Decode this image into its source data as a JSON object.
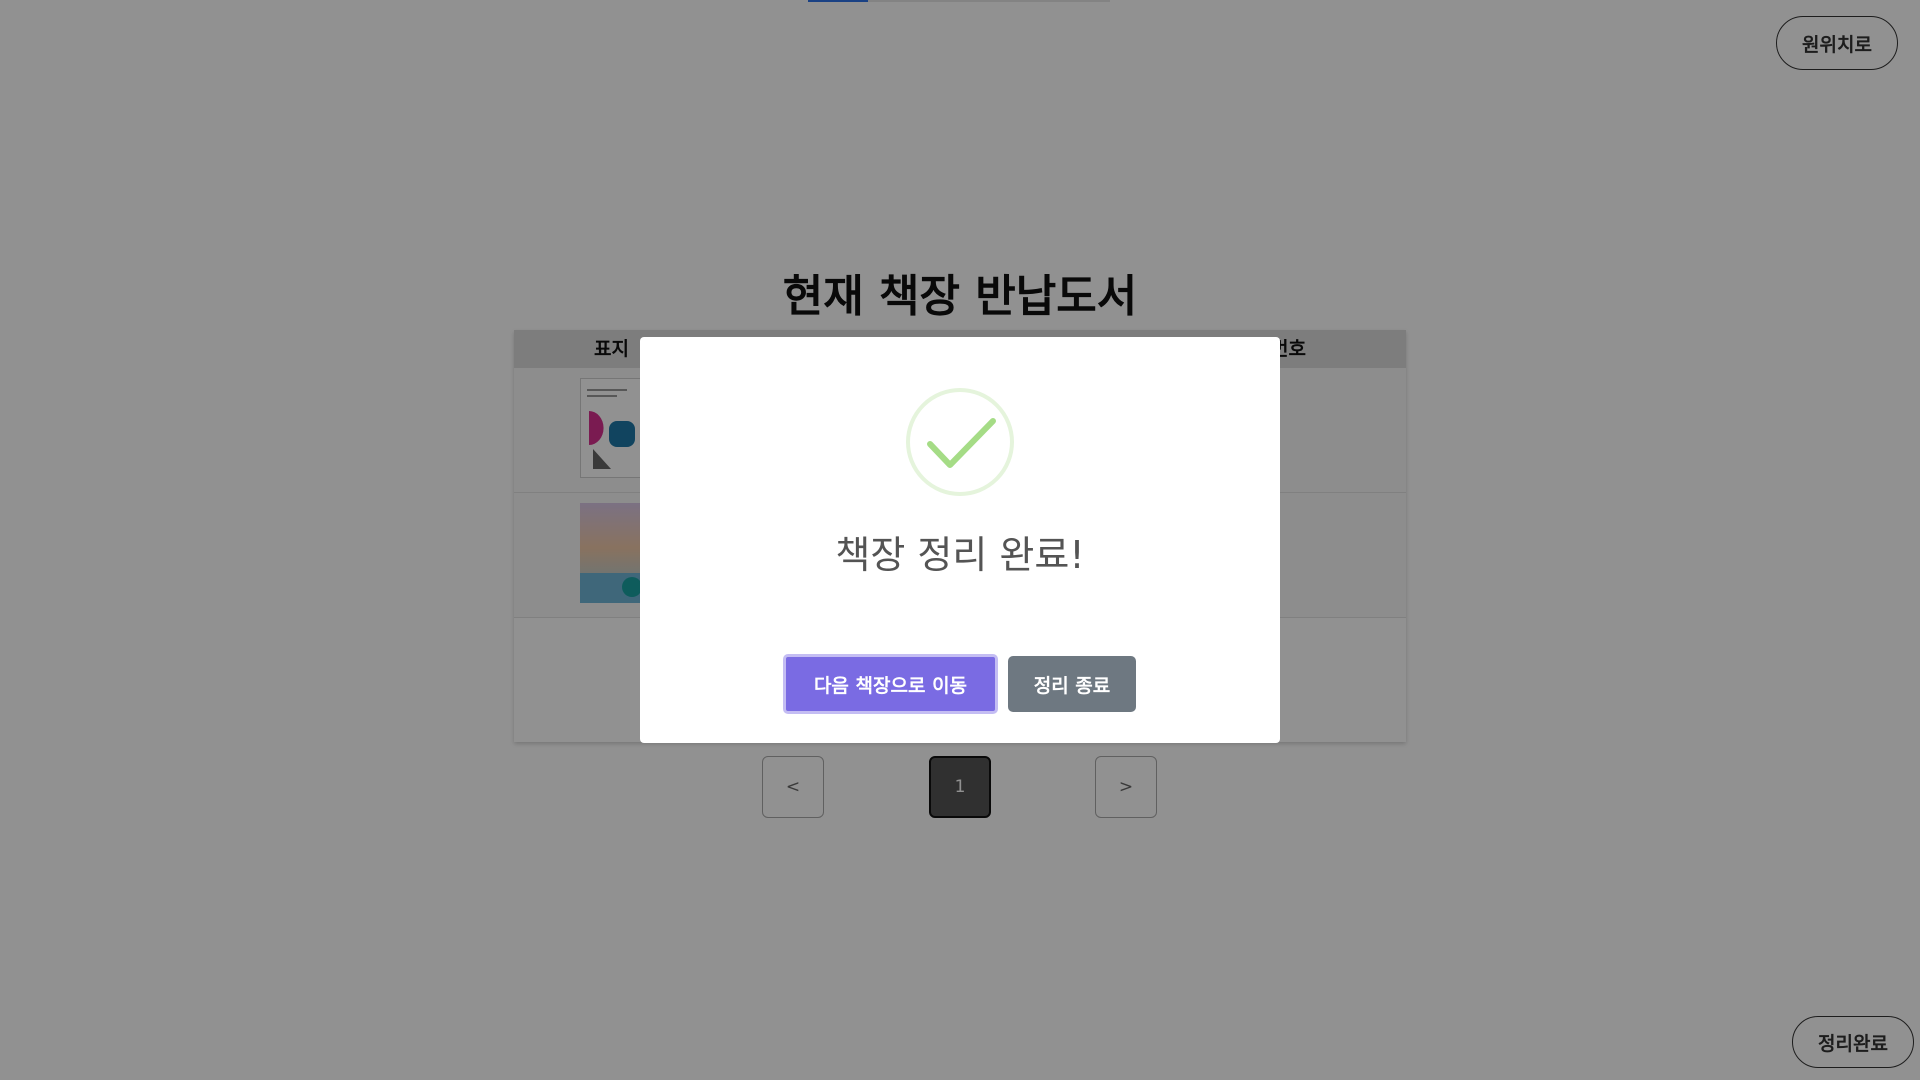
{
  "progress": {
    "fraction": 0.2,
    "accent": "#2f73e8"
  },
  "top_right": {
    "return_label": "원위치로"
  },
  "bottom_right": {
    "done_label": "정리완료"
  },
  "page": {
    "title": "현재 책장 반납도서"
  },
  "table": {
    "headers": {
      "cover": "표지",
      "callno_partial": "번호"
    },
    "rows": [
      {
        "cover_icon": "book-cover-abstract-shapes"
      },
      {
        "cover_icon": "book-cover-sunset-landscape"
      }
    ]
  },
  "pagination": {
    "prev": "<",
    "current": "1",
    "next": ">"
  },
  "modal": {
    "icon": "check-circle-icon",
    "title": "책장 정리 완료!",
    "next_button": "다음 책장으로 이동",
    "end_button": "정리 종료",
    "colors": {
      "primary": "#7a6be3",
      "secondary": "#6e7881",
      "success": "#a5dc86"
    }
  }
}
